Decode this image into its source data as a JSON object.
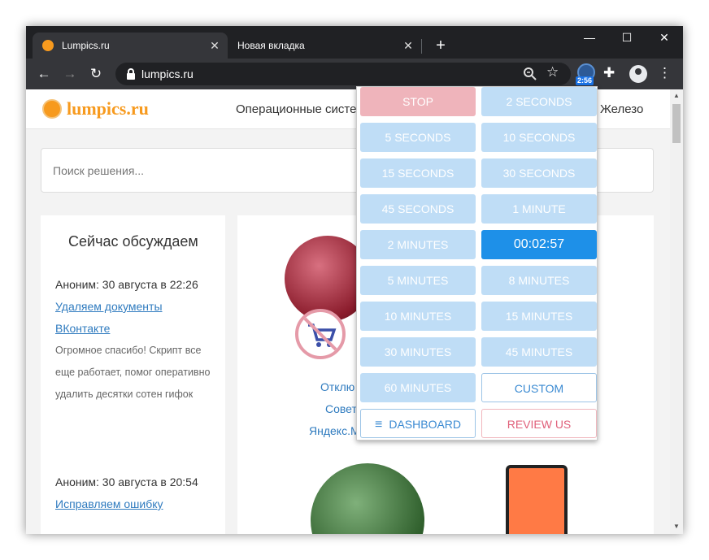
{
  "browser": {
    "tabs": [
      {
        "title": "Lumpics.ru",
        "active": true
      },
      {
        "title": "Новая вкладка",
        "active": false
      }
    ],
    "new_tab": "+",
    "window_controls": {
      "minimize": "—",
      "maximize": "☐",
      "close": "✕"
    },
    "url": "lumpics.ru",
    "extension_badge": "2:56"
  },
  "site": {
    "logo": "lumpics.ru",
    "nav": [
      "Операционные систе",
      "Железо"
    ],
    "search_placeholder": "Поиск решения...",
    "sidebar_title": "Сейчас обсуждаем",
    "comments": [
      {
        "author_time": "Аноним: 30 августа в 22:26",
        "link": "Удаляем документы ВКонтакте",
        "text": "Огромное спасибо! Скрипт все еще работает, помог оперативно удалить десятки сотен гифок"
      },
      {
        "author_time": "Аноним: 30 августа в 20:54",
        "link": "Исправляем ошибку",
        "text": ""
      }
    ],
    "card_text": [
      "Отклю",
      "Совет",
      "Яндекс.М"
    ]
  },
  "popup": {
    "buttons": [
      {
        "label": "STOP",
        "style": "red"
      },
      {
        "label": "2 SECONDS",
        "style": "blue"
      },
      {
        "label": "5 SECONDS",
        "style": "blue"
      },
      {
        "label": "10 SECONDS",
        "style": "blue"
      },
      {
        "label": "15 SECONDS",
        "style": "blue"
      },
      {
        "label": "30 SECONDS",
        "style": "blue"
      },
      {
        "label": "45 SECONDS",
        "style": "blue"
      },
      {
        "label": "1 MINUTE",
        "style": "blue"
      },
      {
        "label": "2 MINUTES",
        "style": "blue"
      },
      {
        "label": "00:02:57",
        "style": "active"
      },
      {
        "label": "5 MINUTES",
        "style": "blue"
      },
      {
        "label": "8 MINUTES",
        "style": "blue"
      },
      {
        "label": "10 MINUTES",
        "style": "blue"
      },
      {
        "label": "15 MINUTES",
        "style": "blue"
      },
      {
        "label": "30 MINUTES",
        "style": "blue"
      },
      {
        "label": "45 MINUTES",
        "style": "blue"
      },
      {
        "label": "60 MINUTES",
        "style": "blue"
      },
      {
        "label": "CUSTOM",
        "style": "custom"
      }
    ],
    "dashboard": "DASHBOARD",
    "review": "REVIEW US"
  }
}
